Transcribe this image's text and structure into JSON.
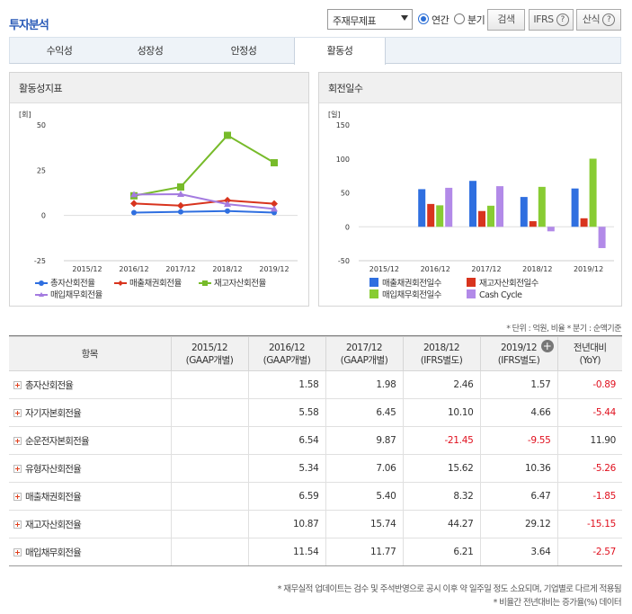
{
  "page": {
    "title": "투자분석"
  },
  "controls": {
    "report_select": "주재무제표",
    "radio_annual": "연간",
    "radio_quarter": "분기",
    "search_button": "검색",
    "ifrs_button": "IFRS",
    "formula_button": "산식",
    "help_glyph": "?"
  },
  "tabs": [
    {
      "label": "수익성",
      "active": false
    },
    {
      "label": "성장성",
      "active": false
    },
    {
      "label": "안정성",
      "active": false
    },
    {
      "label": "활동성",
      "active": true
    }
  ],
  "left_panel": {
    "title": "활동성지표",
    "unit": "[회]"
  },
  "right_panel": {
    "title": "회전일수",
    "unit": "[일]"
  },
  "chart_data": [
    {
      "type": "line",
      "title": "활동성지표",
      "ylabel": "[회]",
      "ylim": [
        -25,
        50
      ],
      "yticks": [
        -25,
        0,
        25,
        50
      ],
      "categories": [
        "2015/12",
        "2016/12",
        "2017/12",
        "2018/12",
        "2019/12"
      ],
      "series": [
        {
          "name": "총자산회전율",
          "color": "#2f6fe0",
          "marker": "circle",
          "values": [
            null,
            1.58,
            1.98,
            2.46,
            1.57
          ]
        },
        {
          "name": "매출채권회전율",
          "color": "#d8341e",
          "marker": "diamond",
          "values": [
            null,
            6.59,
            5.4,
            8.32,
            6.47
          ]
        },
        {
          "name": "재고자산회전율",
          "color": "#77bb2a",
          "marker": "square",
          "values": [
            null,
            10.87,
            15.74,
            44.27,
            29.12
          ]
        },
        {
          "name": "매입채무회전율",
          "color": "#a47be0",
          "marker": "triangle",
          "values": [
            null,
            11.54,
            11.77,
            6.21,
            3.64
          ]
        }
      ],
      "legend": "bottom",
      "grid": false
    },
    {
      "type": "bar",
      "title": "회전일수",
      "ylabel": "[일]",
      "ylim": [
        -50,
        150
      ],
      "yticks": [
        -50,
        0,
        50,
        100,
        150
      ],
      "categories": [
        "2015/12",
        "2016/12",
        "2017/12",
        "2018/12",
        "2019/12"
      ],
      "series": [
        {
          "name": "매출채권회전일수",
          "color": "#2f6fe0",
          "values": [
            null,
            55.4,
            67.6,
            43.9,
            56.4
          ]
        },
        {
          "name": "재고자산회전일수",
          "color": "#d8341e",
          "values": [
            null,
            33.6,
            23.2,
            8.2,
            12.5
          ]
        },
        {
          "name": "매입채무회전일수",
          "color": "#88cc33",
          "values": [
            null,
            31.6,
            31.0,
            58.8,
            100.3
          ]
        },
        {
          "name": "Cash Cycle",
          "color": "#b28ae8",
          "values": [
            null,
            57.4,
            59.8,
            -6.7,
            -31.4
          ]
        }
      ],
      "legend": "bottom",
      "grid": false
    }
  ],
  "unit_note": "* 단위 : 억원, 비율   * 분기 : 순액기준",
  "table": {
    "header_item": "항목",
    "columns": [
      {
        "year": "2015/12",
        "basis": "(GAAP개별)"
      },
      {
        "year": "2016/12",
        "basis": "(GAAP개별)"
      },
      {
        "year": "2017/12",
        "basis": "(GAAP개별)"
      },
      {
        "year": "2018/12",
        "basis": "(IFRS별도)"
      },
      {
        "year": "2019/12",
        "basis": "(IFRS별도)"
      }
    ],
    "yoy_header": "전년대비",
    "yoy_sub": "(YoY)",
    "rows": [
      {
        "name": "총자산회전율",
        "values": [
          "",
          "1.58",
          "1.98",
          "2.46",
          "1.57"
        ],
        "yoy": "-0.89"
      },
      {
        "name": "자기자본회전율",
        "values": [
          "",
          "5.58",
          "6.45",
          "10.10",
          "4.66"
        ],
        "yoy": "-5.44"
      },
      {
        "name": "순운전자본회전율",
        "values": [
          "",
          "6.54",
          "9.87",
          "-21.45",
          "-9.55"
        ],
        "yoy": "11.90"
      },
      {
        "name": "유형자산회전율",
        "values": [
          "",
          "5.34",
          "7.06",
          "15.62",
          "10.36"
        ],
        "yoy": "-5.26"
      },
      {
        "name": "매출채권회전율",
        "values": [
          "",
          "6.59",
          "5.40",
          "8.32",
          "6.47"
        ],
        "yoy": "-1.85"
      },
      {
        "name": "재고자산회전율",
        "values": [
          "",
          "10.87",
          "15.74",
          "44.27",
          "29.12"
        ],
        "yoy": "-15.15"
      },
      {
        "name": "매입채무회전율",
        "values": [
          "",
          "11.54",
          "11.77",
          "6.21",
          "3.64"
        ],
        "yoy": "-2.57"
      }
    ]
  },
  "footnotes": [
    "* 재무실적 업데이트는 검수 및 주석반영으로 공시 이후 약 일주일 정도 소요되며, 기업별로 다르게 적용됨",
    "* 비율간 전년대비는 증가율(%) 데이터"
  ]
}
